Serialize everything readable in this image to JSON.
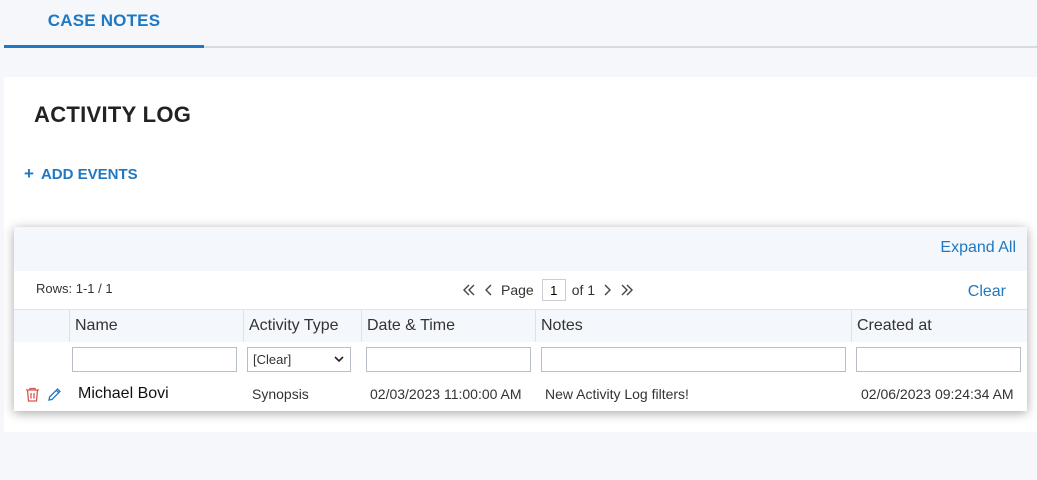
{
  "tabs": [
    {
      "label": "CASE NOTES",
      "active": true
    }
  ],
  "page": {
    "title": "ACTIVITY LOG",
    "add_events_plus": "+",
    "add_events_label": "ADD EVENTS"
  },
  "grid": {
    "expand_all": "Expand All",
    "rows_info": "Rows: 1-1 / 1",
    "pager": {
      "page_label": "Page",
      "current_page": "1",
      "of_label": "of 1"
    },
    "clear_label": "Clear",
    "columns": [
      "Name",
      "Activity Type",
      "Date & Time",
      "Notes",
      "Created at"
    ],
    "filters": {
      "activity_type_selected": "[Clear]"
    },
    "rows": [
      {
        "name": "Michael Bovi",
        "activity_type": "Synopsis",
        "date_time": "02/03/2023 11:00:00 AM",
        "notes": "New Activity Log filters!",
        "created_at": "02/06/2023 09:24:34 AM"
      }
    ]
  },
  "icons": {
    "delete": "trash-icon",
    "edit": "pencil-icon",
    "first": "double-chevron-left-icon",
    "prev": "chevron-left-icon",
    "next": "chevron-right-icon",
    "last": "double-chevron-right-icon"
  },
  "colors": {
    "accent": "#1f78c1",
    "delete": "#d9534f",
    "background": "#f5f7fa"
  }
}
